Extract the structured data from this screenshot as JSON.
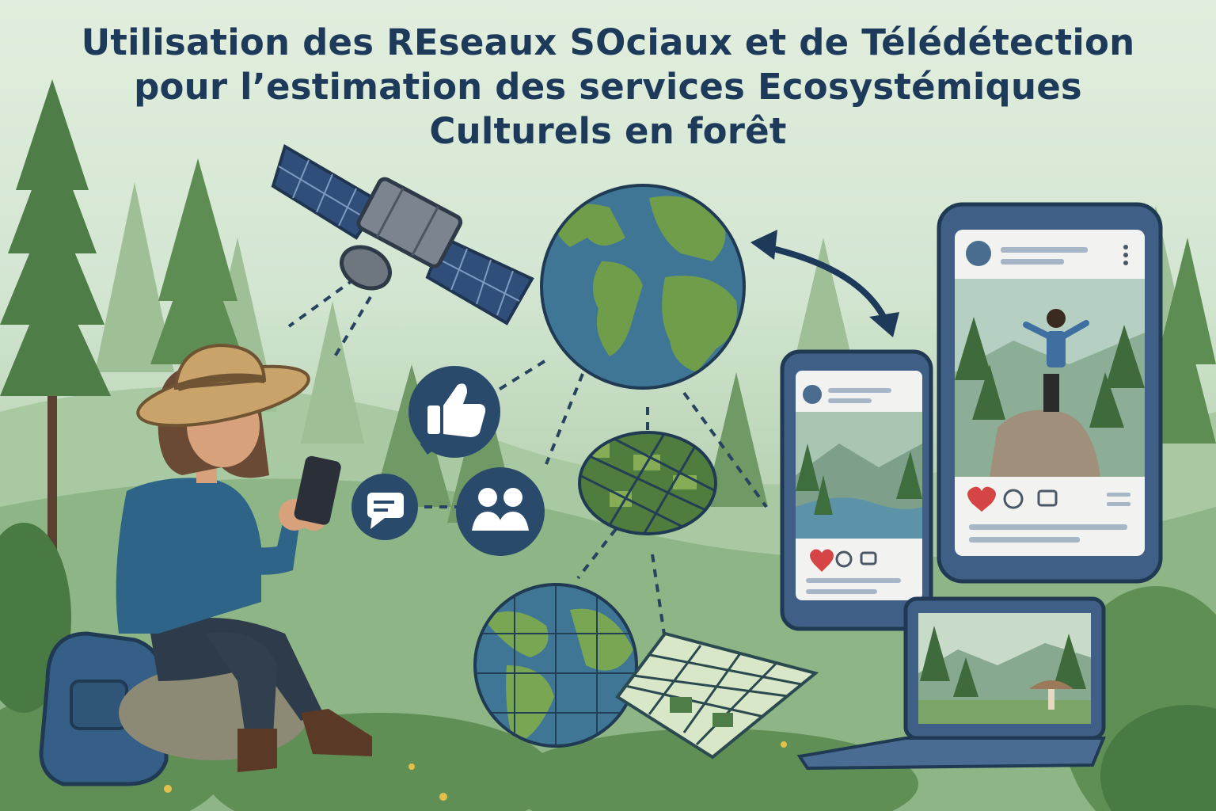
{
  "title": {
    "line1": "Utilisation des REseaux SOciaux et de Télédétection",
    "line2": "pour l’estimation des services Ecosystémiques",
    "line3": "Culturels en forêt"
  },
  "icons": {
    "satellite": "satellite-icon",
    "globe": "globe-icon",
    "like": "thumbs-up-icon",
    "comment": "chat-bubble-icon",
    "community": "people-icon",
    "exchange": "double-arrow-icon",
    "forest_grid": "satellite-imagery-tiles-icon",
    "heart": "heart-icon"
  },
  "colors": {
    "title": "#1d3a5a",
    "forest_dark": "#3f6b3c",
    "forest_light": "#7ea66e",
    "device": "#3f5f86",
    "icon_circle": "#294a6b",
    "heart": "#d64545"
  }
}
